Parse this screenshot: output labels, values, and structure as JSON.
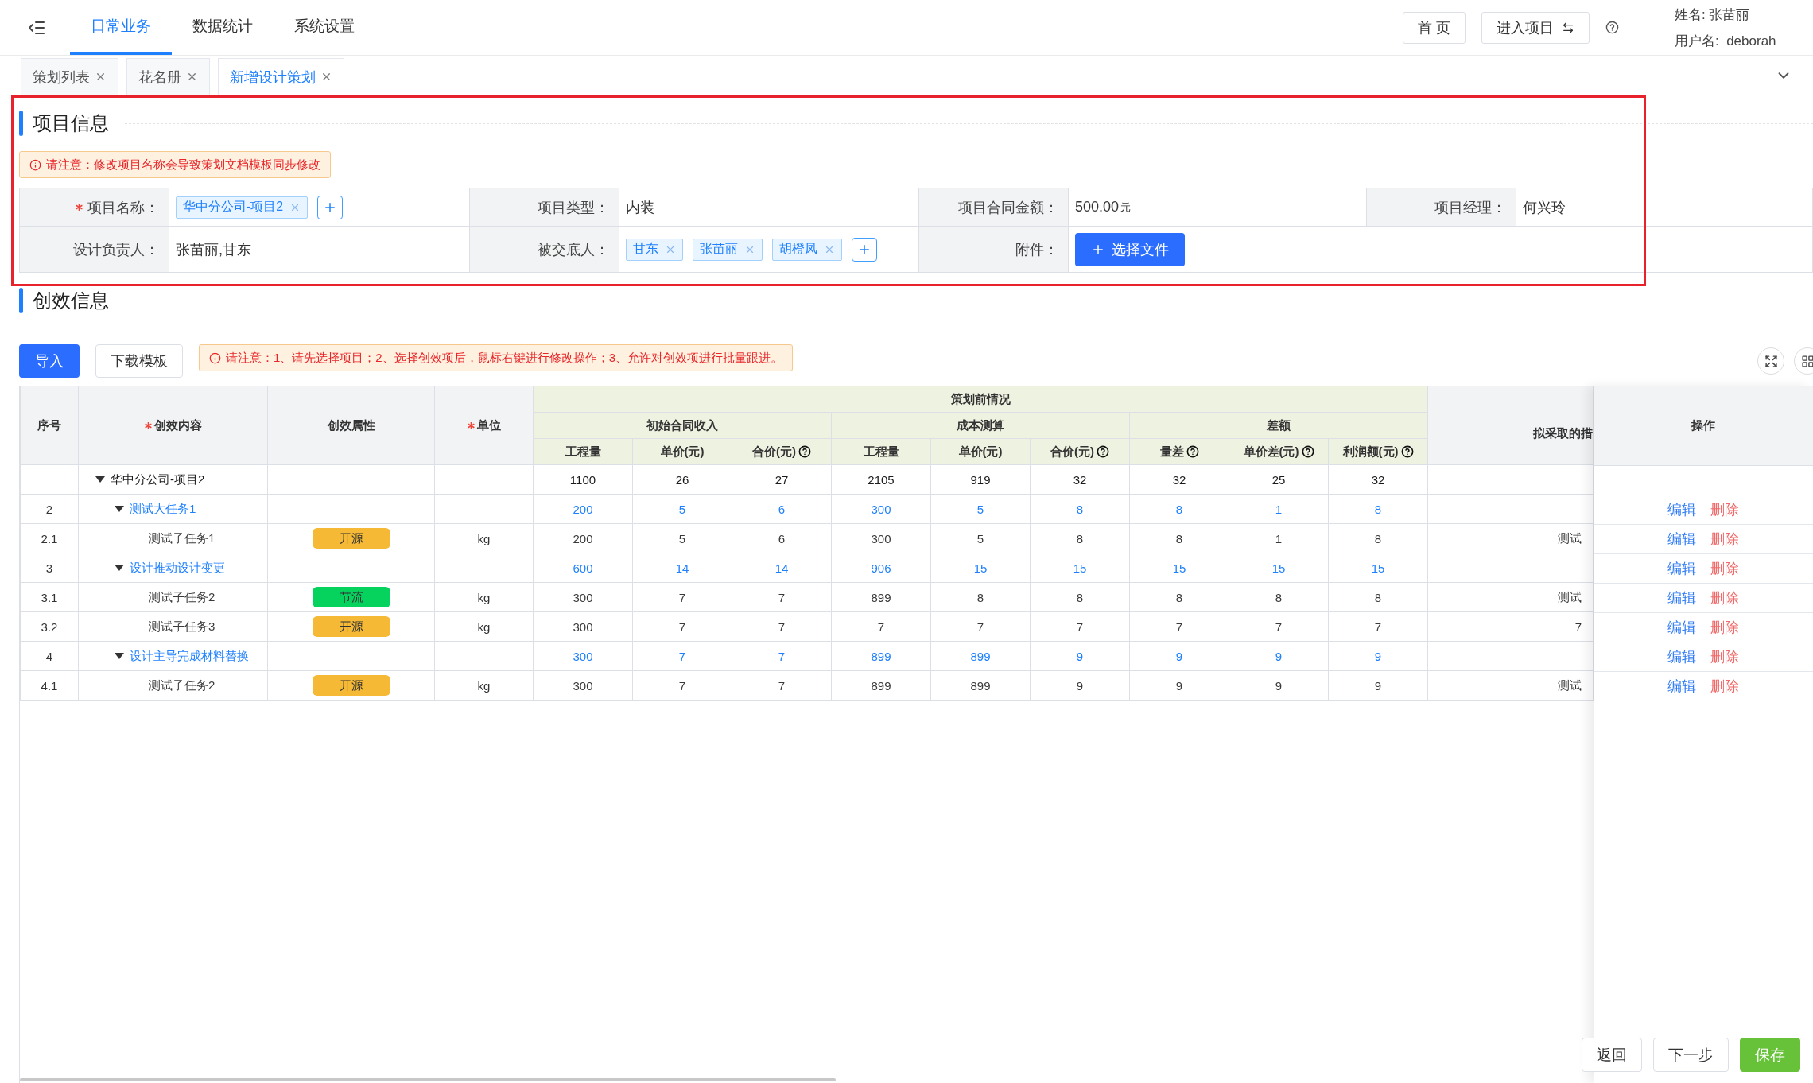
{
  "header": {
    "nav": [
      {
        "label": "日常业务",
        "selected": true
      },
      {
        "label": "数据统计",
        "selected": false
      },
      {
        "label": "系统设置",
        "selected": false
      }
    ],
    "home_button": "首 页",
    "enter_project_button": "进入项目",
    "user_name": "姓名: 张苗丽",
    "user_login": "用户名:  deborah"
  },
  "tabs": [
    {
      "label": "策划列表",
      "selected": false
    },
    {
      "label": "花名册",
      "selected": false
    },
    {
      "label": "新增设计策划",
      "selected": true
    }
  ],
  "project_info": {
    "title": "项目信息",
    "highlighted": true,
    "notice": "请注意：修改项目名称会导致策划文档模板同步修改",
    "rows": [
      [
        {
          "label": "项目名称：",
          "required": true,
          "kind": "tags",
          "tags": [
            "华中分公司-项目2"
          ]
        },
        {
          "label": "项目类型：",
          "kind": "text",
          "value": "内装"
        },
        {
          "label": "项目合同金额：",
          "kind": "amount",
          "value": "500.00",
          "unit": "元"
        },
        {
          "label": "项目经理：",
          "kind": "text",
          "value": "何兴玲"
        }
      ],
      [
        {
          "label": "设计负责人：",
          "kind": "text",
          "value": "张苗丽,甘东"
        },
        {
          "label": "被交底人：",
          "kind": "tags",
          "tags": [
            "甘东",
            "张苗丽",
            "胡橙凤"
          ]
        },
        {
          "label": "附件：",
          "kind": "file",
          "button": "选择文件"
        }
      ]
    ]
  },
  "creative_info": {
    "title": "创效信息",
    "import_button": "导入",
    "download_button": "下载模板",
    "notice": "请注意：1、请先选择项目；2、选择创效项后，鼠标右键进行修改操作；3、允许对创效项进行批量跟进。",
    "columns": [
      {
        "label": "序号",
        "required": false
      },
      {
        "label": "创效内容",
        "required": true
      },
      {
        "label": "创效属性",
        "required": false
      },
      {
        "label": "单位",
        "required": true
      }
    ],
    "group": {
      "label": "策划前情况",
      "subgroups": [
        {
          "label": "初始合同收入",
          "columns": [
            {
              "label": "工程量",
              "help": false
            },
            {
              "label": "单价(元)",
              "help": false
            },
            {
              "label": "合价(元)",
              "help": true
            }
          ]
        },
        {
          "label": "成本测算",
          "columns": [
            {
              "label": "工程量",
              "help": false
            },
            {
              "label": "单价(元)",
              "help": false
            },
            {
              "label": "合价(元)",
              "help": true
            }
          ]
        },
        {
          "label": "差额",
          "columns": [
            {
              "label": "量差",
              "help": true
            },
            {
              "label": "单价差(元)",
              "help": true
            },
            {
              "label": "利润额(元)",
              "help": true
            }
          ]
        }
      ]
    },
    "measure_column": "拟采取的措",
    "actions_column": "操作",
    "rows": [
      {
        "kind": "root",
        "index": "",
        "content": "华中分公司-项目2",
        "expanded": true,
        "values": [
          "1100",
          "26",
          "27",
          "2105",
          "919",
          "32",
          "32",
          "25",
          "32"
        ],
        "children": [
          {
            "kind": "task",
            "index": "2",
            "content": "测试大任务1",
            "expanded": true,
            "values": [
              "200",
              "5",
              "6",
              "300",
              "5",
              "8",
              "8",
              "1",
              "8"
            ],
            "actions": [
              "编辑",
              "删除"
            ],
            "children": [
              {
                "kind": "subtask",
                "index": "2.1",
                "content": "测试子任务1",
                "attribute": {
                  "label": "开源",
                  "color": "#f5b935"
                },
                "unit": "kg",
                "values": [
                  "200",
                  "5",
                  "6",
                  "300",
                  "5",
                  "8",
                  "8",
                  "1",
                  "8"
                ],
                "measure": "测试",
                "actions": [
                  "编辑",
                  "删除"
                ]
              }
            ]
          },
          {
            "kind": "task",
            "index": "3",
            "content": "设计推动设计变更",
            "expanded": true,
            "values": [
              "600",
              "14",
              "14",
              "906",
              "15",
              "15",
              "15",
              "15",
              "15"
            ],
            "actions": [
              "编辑",
              "删除"
            ],
            "children": [
              {
                "kind": "subtask",
                "index": "3.1",
                "content": "测试子任务2",
                "attribute": {
                  "label": "节流",
                  "color": "#06d35d"
                },
                "unit": "kg",
                "values": [
                  "300",
                  "7",
                  "7",
                  "899",
                  "8",
                  "8",
                  "8",
                  "8",
                  "8"
                ],
                "measure": "测试",
                "actions": [
                  "编辑",
                  "删除"
                ]
              },
              {
                "kind": "subtask",
                "index": "3.2",
                "content": "测试子任务3",
                "attribute": {
                  "label": "开源",
                  "color": "#f5b935"
                },
                "unit": "kg",
                "values": [
                  "300",
                  "7",
                  "7",
                  "7",
                  "7",
                  "7",
                  "7",
                  "7",
                  "7"
                ],
                "measure": "7",
                "actions": [
                  "编辑",
                  "删除"
                ]
              }
            ]
          },
          {
            "kind": "task",
            "index": "4",
            "content": "设计主导完成材料替换",
            "expanded": true,
            "values": [
              "300",
              "7",
              "7",
              "899",
              "899",
              "9",
              "9",
              "9",
              "9"
            ],
            "actions": [
              "编辑",
              "删除"
            ],
            "children": [
              {
                "kind": "subtask",
                "index": "4.1",
                "content": "测试子任务2",
                "attribute": {
                  "label": "开源",
                  "color": "#f5b935"
                },
                "unit": "kg",
                "values": [
                  "300",
                  "7",
                  "7",
                  "899",
                  "899",
                  "9",
                  "9",
                  "9",
                  "9"
                ],
                "measure": "测试",
                "actions": [
                  "编辑",
                  "删除"
                ]
              }
            ]
          }
        ]
      }
    ]
  },
  "footer": {
    "back_button": "返回",
    "next_button": "下一步",
    "save_button": "保存"
  }
}
